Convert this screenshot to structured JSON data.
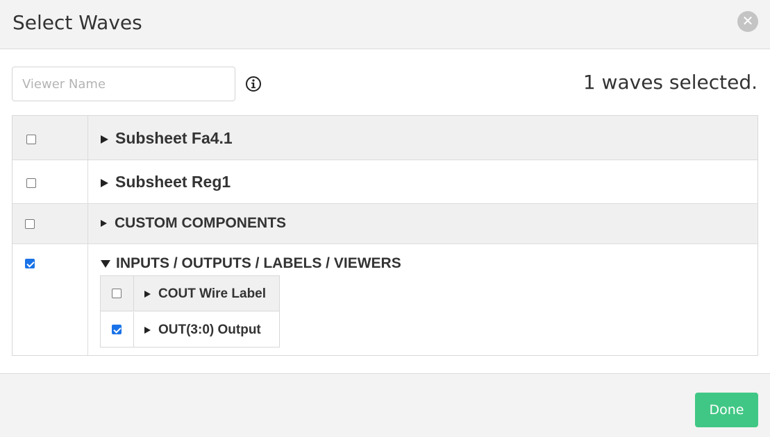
{
  "dialog": {
    "title": "Select Waves",
    "close_icon": "close-icon"
  },
  "viewer": {
    "placeholder": "Viewer Name",
    "value": "",
    "info_icon": "info-icon"
  },
  "selection": {
    "count_text": "1 waves selected."
  },
  "groups": [
    {
      "label": "Subsheet Fa4.1",
      "checked": false,
      "expanded": false
    },
    {
      "label": "Subsheet Reg1",
      "checked": false,
      "expanded": false
    },
    {
      "label": "CUSTOM COMPONENTS",
      "checked": false,
      "expanded": false
    },
    {
      "label": "INPUTS / OUTPUTS / LABELS / VIEWERS",
      "checked": true,
      "expanded": true,
      "items": [
        {
          "label": "COUT Wire Label",
          "checked": false,
          "expanded": false
        },
        {
          "label": "OUT(3:0) Output",
          "checked": true,
          "expanded": false
        }
      ]
    }
  ],
  "footer": {
    "done_label": "Done",
    "done_color": "#41c785"
  },
  "colors": {
    "checkbox_checked": "#1a73e8",
    "header_bg": "#f3f3f3",
    "row_shaded": "#f0f0f0"
  }
}
